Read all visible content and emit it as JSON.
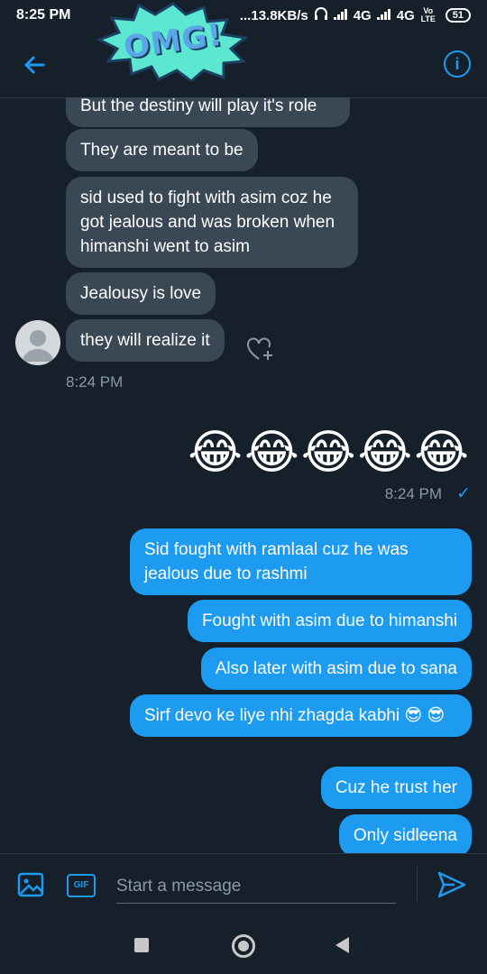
{
  "status_bar": {
    "time": "8:25 PM",
    "network_speed": "...13.8KB/s",
    "signal1": "4G",
    "signal2": "4G",
    "volte": "Vo LTE",
    "battery": "51"
  },
  "header": {
    "badge_text": "OMG!",
    "back_icon": "back-arrow-icon",
    "info_icon": "info-icon"
  },
  "conversation": {
    "incoming": [
      "But the destiny will play it's role",
      "They are meant to be",
      "sid used to fight with asim coz he got jealous and was broken when himanshi went to asim",
      "Jealousy is love",
      "they will realize it"
    ],
    "incoming_time": "8:24 PM",
    "emoji_message": "😂😂😂😂😂",
    "emoji_time": "8:24 PM",
    "read_receipt": "✓",
    "outgoing": [
      "Sid fought with ramlaal cuz he was jealous due to rashmi",
      "Fought with asim due to himanshi",
      "Also later with asim due to sana",
      "Sirf devo ke liye nhi zhagda kabhi 😎 😎",
      "Cuz he trust her",
      "Only sidleena"
    ]
  },
  "composer": {
    "placeholder": "Start a message",
    "gif_label": "GIF"
  },
  "colors": {
    "background": "#15202b",
    "incoming_bubble": "#3a4754",
    "outgoing_bubble": "#1d9bf0",
    "accent": "#1d9bf0"
  }
}
